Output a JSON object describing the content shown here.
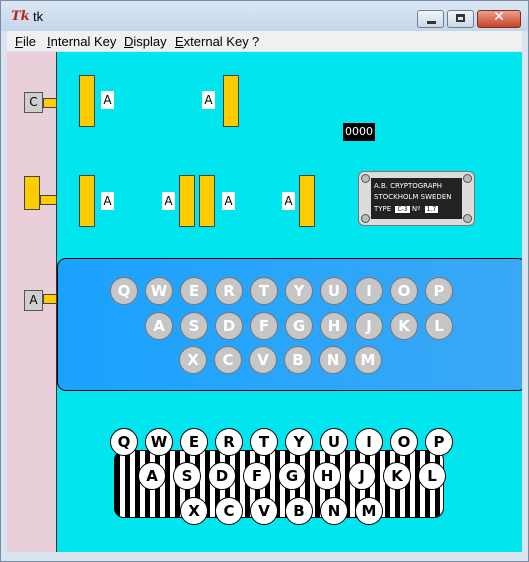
{
  "window": {
    "title": "tk",
    "app_icon": "tk-feather-icon"
  },
  "menu": [
    {
      "label": "File"
    },
    {
      "label": "Internal Key"
    },
    {
      "label": "Display"
    },
    {
      "label": "External Key"
    },
    {
      "label": "?"
    }
  ],
  "side_buttons": {
    "top": "C",
    "bottom": "A"
  },
  "rotor_labels": {
    "row1": [
      "A",
      "A"
    ],
    "row2": [
      "A",
      "A",
      "A",
      "A"
    ]
  },
  "counter": "0000",
  "plate": {
    "line1": "A.B. CRYPTOGRAPH",
    "line2": "STOCKHOLM SWEDEN",
    "type_label": "TYPE",
    "type_value": "C-3",
    "no_label": "Nº",
    "no_value": "1.7"
  },
  "lamps": {
    "row1": [
      "Q",
      "W",
      "E",
      "R",
      "T",
      "Y",
      "U",
      "I",
      "O",
      "P"
    ],
    "row2": [
      "A",
      "S",
      "D",
      "F",
      "G",
      "H",
      "J",
      "K",
      "L"
    ],
    "row3": [
      "X",
      "C",
      "V",
      "B",
      "N",
      "M"
    ]
  },
  "keys": {
    "row1": [
      "Q",
      "W",
      "E",
      "R",
      "T",
      "Y",
      "U",
      "I",
      "O",
      "P"
    ],
    "row2": [
      "A",
      "S",
      "D",
      "F",
      "G",
      "H",
      "J",
      "K",
      "L"
    ],
    "row3": [
      "X",
      "C",
      "V",
      "B",
      "N",
      "M"
    ]
  },
  "colors": {
    "canvas": "#00e5ee",
    "sidebar": "#e8cfd9",
    "rotor": "#ffcc00",
    "lamp_panel": "#1aa2ff",
    "lamp": "#c6c6c6"
  }
}
